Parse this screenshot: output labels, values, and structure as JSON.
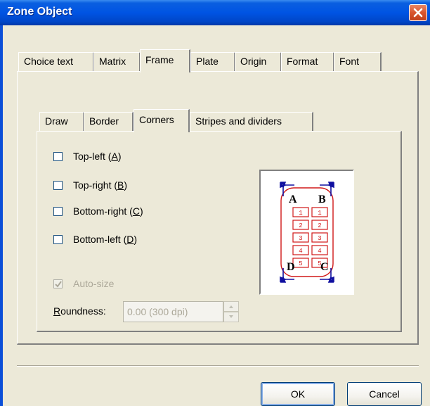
{
  "window": {
    "title": "Zone Object"
  },
  "tabs": [
    {
      "label": "Choice text",
      "selected": false
    },
    {
      "label": "Matrix",
      "selected": false
    },
    {
      "label": "Frame",
      "selected": true
    },
    {
      "label": "Plate",
      "selected": false
    },
    {
      "label": "Origin",
      "selected": false
    },
    {
      "label": "Format",
      "selected": false
    },
    {
      "label": "Font",
      "selected": false
    }
  ],
  "subtabs": [
    {
      "label": "Draw",
      "selected": false
    },
    {
      "label": "Border",
      "selected": false
    },
    {
      "label": "Corners",
      "selected": true
    },
    {
      "label": "Stripes and dividers",
      "selected": false
    }
  ],
  "corners": {
    "options": [
      {
        "text": "Top-left (",
        "key": "A",
        "close": ")",
        "checked": false
      },
      {
        "text": "Top-right (",
        "key": "B",
        "close": ")",
        "checked": false
      },
      {
        "text": "Bottom-right (",
        "key": "C",
        "close": ")",
        "checked": false
      },
      {
        "text": "Bottom-left (",
        "key": "D",
        "close": ")",
        "checked": false
      }
    ],
    "autosize": {
      "label": "Auto-size",
      "checked": true,
      "disabled": true
    },
    "roundness": {
      "label_key": "R",
      "label_rest": "oundness:",
      "value": "0.00 (300 dpi)",
      "disabled": true
    }
  },
  "preview": {
    "corner_labels": [
      "A",
      "B",
      "C",
      "D"
    ],
    "cells": [
      "1",
      "1",
      "2",
      "2",
      "3",
      "3",
      "4",
      "4",
      "5",
      "5"
    ],
    "frame_color": "#d01818",
    "arrow_color": "#1010a0"
  },
  "buttons": {
    "ok": "OK",
    "cancel": "Cancel"
  }
}
